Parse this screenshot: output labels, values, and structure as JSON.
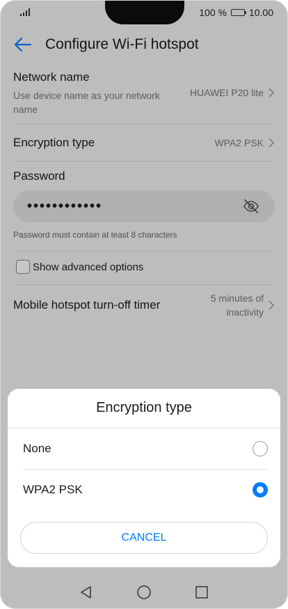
{
  "status_bar": {
    "battery": "100 %",
    "time": "10.00"
  },
  "toolbar": {
    "title": "Configure Wi-Fi hotspot",
    "back_icon": "arrow-left-icon"
  },
  "settings": {
    "network_name": {
      "label": "Network name",
      "sublabel": "Use device name as your network name",
      "value": "HUAWEI P20 lite"
    },
    "encryption_type": {
      "label": "Encryption type",
      "value": "WPA2 PSK"
    },
    "password": {
      "label": "Password",
      "value": "••••••••••••",
      "hint": "Password must contain at least 8 characters"
    },
    "advanced": {
      "label": "Show advanced options",
      "checked": false
    },
    "timer": {
      "label": "Mobile hotspot turn-off timer",
      "value_line1": "5 minutes of",
      "value_line2": "inactivity"
    }
  },
  "dialog": {
    "title": "Encryption type",
    "options": [
      {
        "label": "None",
        "selected": false
      },
      {
        "label": "WPA2 PSK",
        "selected": true
      }
    ],
    "cancel_label": "CANCEL"
  },
  "colors": {
    "accent": "#007dff",
    "background": "#f2f2f2"
  }
}
